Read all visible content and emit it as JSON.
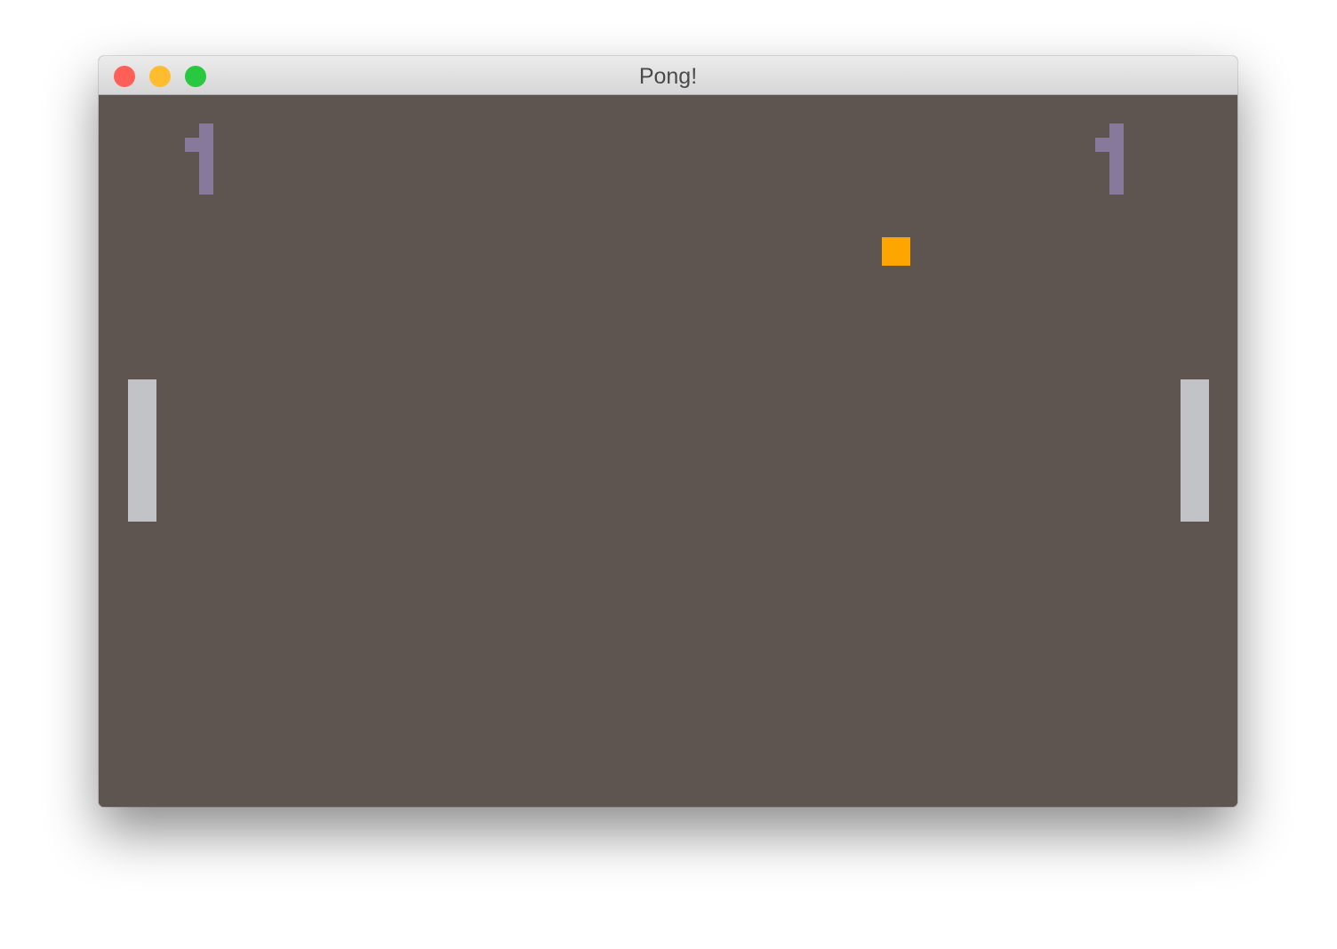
{
  "window": {
    "title": "Pong!"
  },
  "colors": {
    "background": "#5e5550",
    "score": "#86799b",
    "paddle": "#c2c3c6",
    "ball": "#ffa500",
    "close": "#ff5f57",
    "minimize": "#febc2e",
    "zoom": "#28c840"
  },
  "score": {
    "left": "1",
    "right": "1"
  }
}
